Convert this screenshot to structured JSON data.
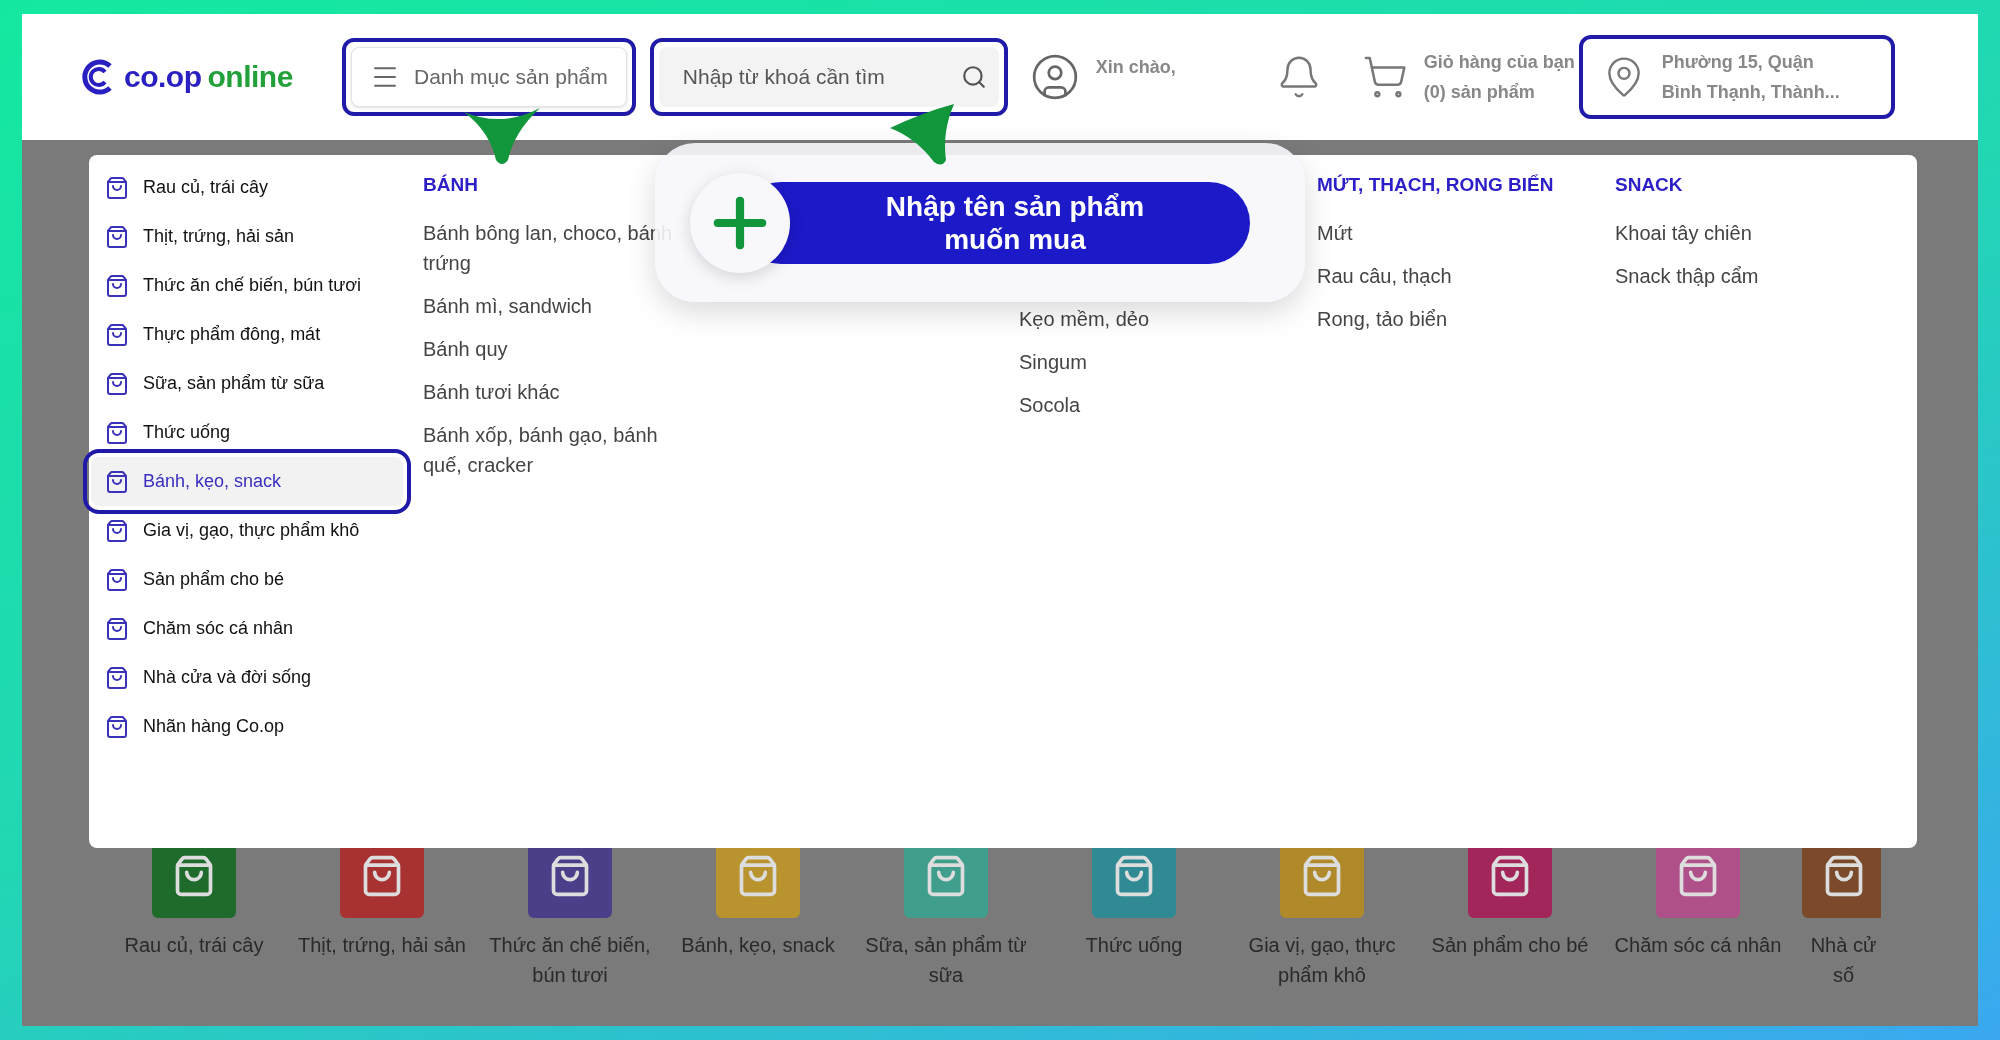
{
  "logo": {
    "brand": "co.op",
    "suffix": "online"
  },
  "header": {
    "menu_button": {
      "label": "Danh mục sản phẩm",
      "highlighted": true
    },
    "search": {
      "placeholder": "Nhập từ khoá cần tìm",
      "highlighted": true
    },
    "greeting": "Xin chào,",
    "cart": {
      "title": "Giỏ hàng của bạn",
      "count": "(0) sản phẩm"
    },
    "location": {
      "line1": "Phường 15, Quận",
      "line2": "Bình Thạnh, Thành...",
      "highlighted": true
    }
  },
  "categories": [
    {
      "label": "Rau củ, trái cây",
      "selected": false
    },
    {
      "label": "Thịt, trứng, hải sản",
      "selected": false
    },
    {
      "label": "Thức ăn chế biến, bún tươi",
      "selected": false
    },
    {
      "label": "Thực phẩm đông, mát",
      "selected": false
    },
    {
      "label": "Sữa, sản phẩm từ sữa",
      "selected": false
    },
    {
      "label": "Thức uống",
      "selected": false
    },
    {
      "label": "Bánh, kẹo, snack",
      "selected": true
    },
    {
      "label": "Gia vị, gạo, thực phẩm khô",
      "selected": false
    },
    {
      "label": "Sản phẩm cho bé",
      "selected": false
    },
    {
      "label": "Chăm sóc cá nhân",
      "selected": false
    },
    {
      "label": "Nhà cửa và đời sống",
      "selected": false
    },
    {
      "label": "Nhãn hàng Co.op",
      "selected": false
    }
  ],
  "subcategories": [
    {
      "heading": "BÁNH",
      "items": [
        "Bánh bông lan, choco, bánh trứng",
        "Bánh mì, sandwich",
        "Bánh quy",
        "Bánh tươi khác",
        "Bánh xốp, bánh gạo, bánh quế, cracker"
      ]
    },
    {
      "items": [
        "Kẹo mềm, dẻo",
        "Singum",
        "Socola"
      ]
    },
    {
      "heading": "MỨT, THẠCH, RONG BIỂN",
      "items": [
        "Mứt",
        "Rau câu, thạch",
        "Rong, tảo biển"
      ]
    },
    {
      "heading": "SNACK",
      "items": [
        "Khoai tây chiên",
        "Snack thập cẩm"
      ]
    }
  ],
  "callout": {
    "text": "Nhập tên sản phẩm muốn mua"
  },
  "category_tiles": [
    {
      "label": "Rau củ, trái cây",
      "color": "#1f6b2c"
    },
    {
      "label": "Thịt, trứng, hải sản",
      "color": "#a83232"
    },
    {
      "label": "Thức ăn chế biến,\nbún tươi",
      "color": "#4b3f8a"
    },
    {
      "label": "Bánh, kẹo, snack",
      "color": "#b8932e"
    },
    {
      "label": "Sữa, sản phẩm từ\nsữa",
      "color": "#3f9e8c"
    },
    {
      "label": "Thức uống",
      "color": "#2f8a94"
    },
    {
      "label": "Gia vị, gạo, thực\nphẩm khô",
      "color": "#b08a2a"
    },
    {
      "label": "Sản phẩm cho bé",
      "color": "#a3265a"
    },
    {
      "label": "Chăm sóc cá nhân",
      "color": "#b0508a"
    },
    {
      "label": "Nhà cử\nsố",
      "color": "#7a4a2a"
    }
  ]
}
